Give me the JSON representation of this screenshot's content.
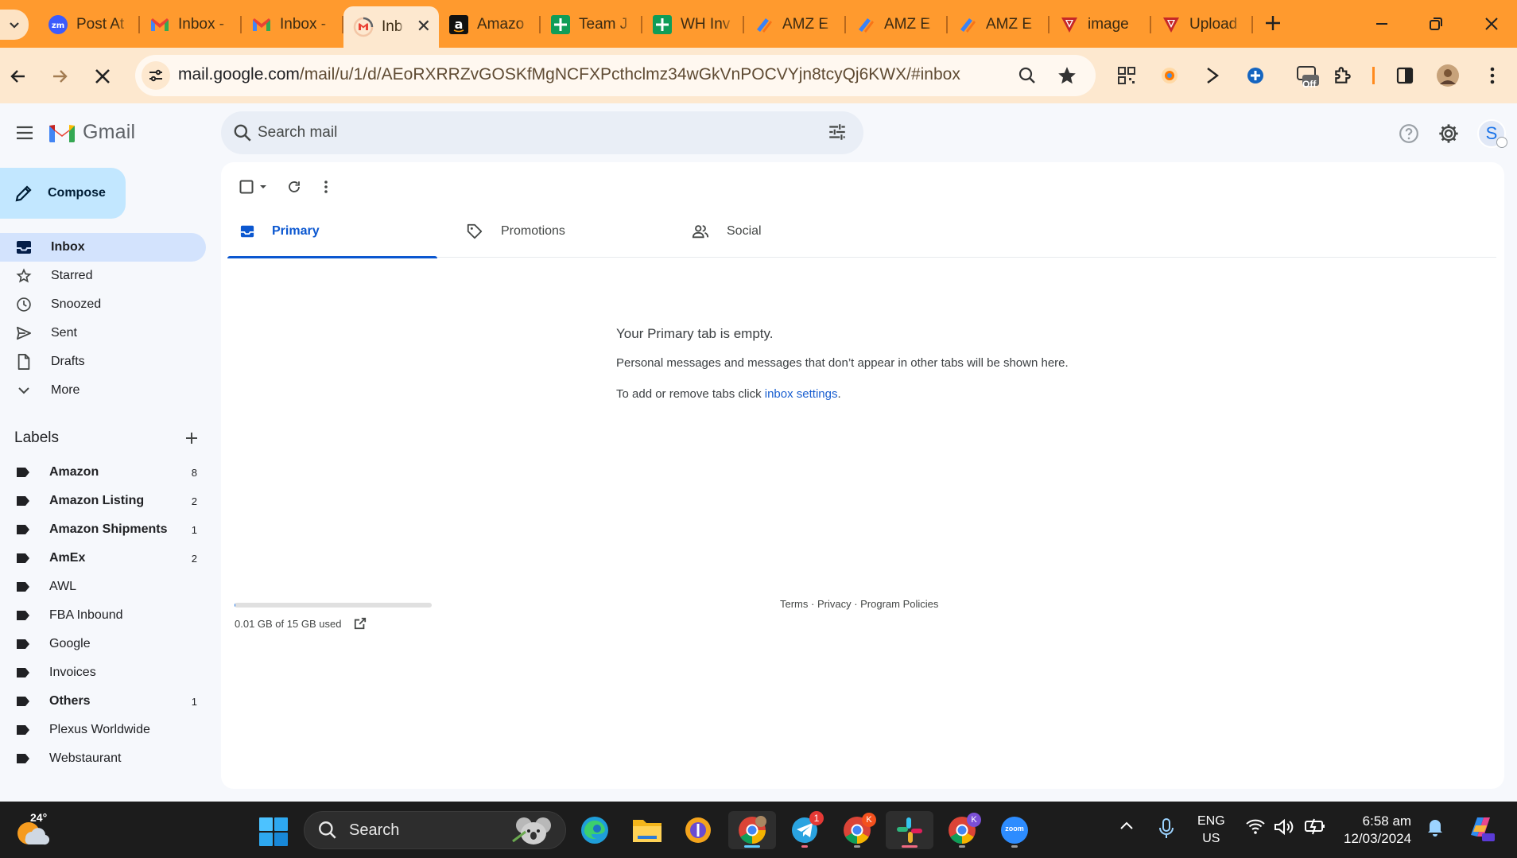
{
  "browser": {
    "tabs": [
      {
        "title": "Post At",
        "icon": "zoom-icon"
      },
      {
        "title": "Inbox -",
        "icon": "gmail-icon"
      },
      {
        "title": "Inbox -",
        "icon": "gmail-icon"
      },
      {
        "title": "Inb",
        "icon": "gmail-loading-icon",
        "active": true
      },
      {
        "title": "Amazo",
        "icon": "amazon-icon"
      },
      {
        "title": "Team J",
        "icon": "sheets-icon"
      },
      {
        "title": "WH Inv",
        "icon": "sheets-icon"
      },
      {
        "title": "AMZ E",
        "icon": "pencil-app-icon"
      },
      {
        "title": "AMZ E",
        "icon": "pencil-app-icon"
      },
      {
        "title": "AMZ E",
        "icon": "pencil-app-icon"
      },
      {
        "title": "image",
        "icon": "red-v-icon"
      },
      {
        "title": "Upload",
        "icon": "red-v-icon"
      }
    ],
    "url_host": "mail.google.com",
    "url_path": "/mail/u/1/d/AEoRXRRZvGOSKfMgNCFXPcthclmz34wGkVnPOCVYjn8tcyQj6KWX/#inbox",
    "off_badge": "Off",
    "colors": {
      "tabstrip": "#ff9a2e",
      "toolbar": "#fde8cf"
    }
  },
  "gmail": {
    "logo_text": "Gmail",
    "search_placeholder": "Search mail",
    "avatar_initial": "S",
    "compose_label": "Compose",
    "nav": [
      {
        "label": "Inbox",
        "icon": "inbox-icon",
        "active": true
      },
      {
        "label": "Starred",
        "icon": "star-icon"
      },
      {
        "label": "Snoozed",
        "icon": "clock-icon"
      },
      {
        "label": "Sent",
        "icon": "send-icon"
      },
      {
        "label": "Drafts",
        "icon": "draft-icon"
      },
      {
        "label": "More",
        "icon": "chevron-down-icon"
      }
    ],
    "labels_title": "Labels",
    "labels": [
      {
        "name": "Amazon",
        "count": "8",
        "unread": true
      },
      {
        "name": "Amazon Listing",
        "count": "2",
        "unread": true
      },
      {
        "name": "Amazon Shipments",
        "count": "1",
        "unread": true
      },
      {
        "name": "AmEx",
        "count": "2",
        "unread": true
      },
      {
        "name": "AWL",
        "count": "",
        "unread": false
      },
      {
        "name": "FBA Inbound",
        "count": "",
        "unread": false
      },
      {
        "name": "Google",
        "count": "",
        "unread": false
      },
      {
        "name": "Invoices",
        "count": "",
        "unread": false
      },
      {
        "name": "Others",
        "count": "1",
        "unread": true
      },
      {
        "name": "Plexus Worldwide",
        "count": "",
        "unread": false
      },
      {
        "name": "Webstaurant",
        "count": "",
        "unread": false
      }
    ],
    "category_tabs": [
      {
        "label": "Primary",
        "icon": "inbox-icon",
        "active": true
      },
      {
        "label": "Promotions",
        "icon": "tag-icon"
      },
      {
        "label": "Social",
        "icon": "people-icon"
      }
    ],
    "empty": {
      "title": "Your Primary tab is empty.",
      "line1": "Personal messages and messages that don’t appear in other tabs will be shown here.",
      "line2_prefix": "To add or remove tabs click ",
      "line2_link": "inbox settings",
      "line2_suffix": "."
    },
    "storage": {
      "text": "0.01 GB of 15 GB used",
      "fraction": 0.001
    },
    "footer": {
      "terms": "Terms",
      "privacy": "Privacy",
      "policies": "Program Policies",
      "sep": " · "
    },
    "colors": {
      "compose": "#c2e7ff",
      "active_nav": "#d3e3fd",
      "primary_accent": "#0b57d0"
    }
  },
  "taskbar": {
    "weather_temp": "24°",
    "search_label": "Search",
    "telegram_badge": "1",
    "chrome_profile_k1": "K",
    "chrome_profile_k2": "K",
    "zoom_label": "zoom",
    "lang_line1": "ENG",
    "lang_line2": "US",
    "time": "6:58 am",
    "date": "12/03/2024"
  }
}
